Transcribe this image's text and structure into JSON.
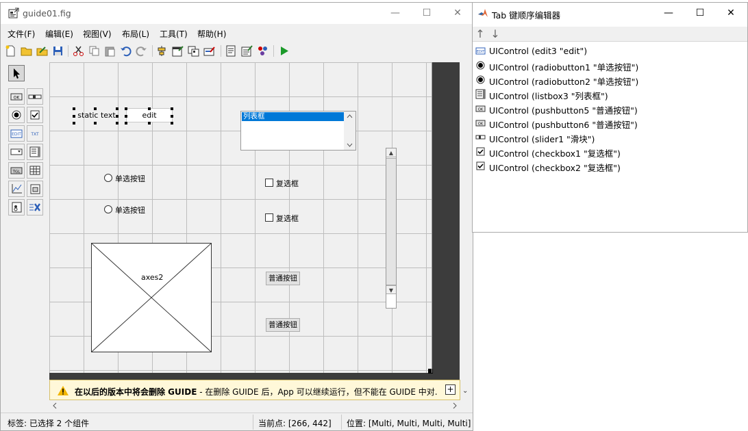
{
  "guide_window": {
    "title": "guide01.fig",
    "menu": [
      "文件(F)",
      "编辑(E)",
      "视图(V)",
      "布局(L)",
      "工具(T)",
      "帮助(H)"
    ],
    "components": {
      "static_text": "static text",
      "edit": "edit",
      "listbox_item": "列表框",
      "radio1": "单选按钮",
      "radio2": "单选按钮",
      "checkbox1": "复选框",
      "checkbox2": "复选框",
      "axes": "axes2",
      "pushbutton1": "普通按钮",
      "pushbutton2": "普通按钮"
    },
    "banner": {
      "bold": "在以后的版本中将会删除 GUIDE",
      "text": " - 在删除 GUIDE 后，App 可以继续运行，但不能在 GUIDE 中对..."
    },
    "status": {
      "label": "标签: 已选择 2 个组件",
      "current_point": "当前点:  [266, 442]",
      "position": "位置: [Multi, Multi, Multi, Multi]"
    }
  },
  "tab_editor": {
    "title": "Tab 键顺序编辑器",
    "items": [
      {
        "icon": "edit-icon",
        "text": "UIControl (edit3 \"edit\")"
      },
      {
        "icon": "radio-icon",
        "text": "UIControl (radiobutton1 \"单选按钮\")"
      },
      {
        "icon": "radio-icon",
        "text": "UIControl (radiobutton2 \"单选按钮\")"
      },
      {
        "icon": "listbox-icon",
        "text": "UIControl (listbox3 \"列表框\")"
      },
      {
        "icon": "pushbutton-icon",
        "text": "UIControl (pushbutton5 \"普通按钮\")"
      },
      {
        "icon": "pushbutton-icon",
        "text": "UIControl (pushbutton6 \"普通按钮\")"
      },
      {
        "icon": "slider-icon",
        "text": "UIControl (slider1 \"滑块\")"
      },
      {
        "icon": "checkbox-icon",
        "text": "UIControl (checkbox1 \"复选框\")"
      },
      {
        "icon": "checkbox-icon",
        "text": "UIControl (checkbox2 \"复选框\")"
      }
    ]
  }
}
